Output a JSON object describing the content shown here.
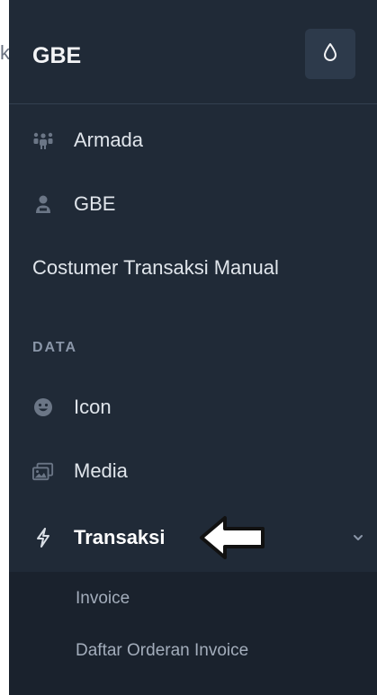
{
  "edge_fragment": "k",
  "brand": {
    "title": "GBE"
  },
  "theme_toggle": {
    "icon": "droplet-icon"
  },
  "menu": [
    {
      "id": "armada",
      "label": "Armada",
      "icon": "users-icon"
    },
    {
      "id": "gbe",
      "label": "GBE",
      "icon": "user-tie-icon"
    },
    {
      "id": "costumer",
      "label": "Costumer Transaksi Manual",
      "icon": ""
    }
  ],
  "section": {
    "label": "DATA"
  },
  "data_menu": [
    {
      "id": "icon",
      "label": "Icon",
      "icon": "smile-icon"
    },
    {
      "id": "media",
      "label": "Media",
      "icon": "images-icon"
    },
    {
      "id": "transaksi",
      "label": "Transaksi",
      "icon": "bolt-icon",
      "active": true,
      "expanded": true
    }
  ],
  "submenu": [
    {
      "label": "Invoice"
    },
    {
      "label": "Daftar Orderan Invoice"
    }
  ],
  "annotation": {
    "type": "arrow-pointing-left"
  },
  "colors": {
    "sidebar_bg": "#202a37",
    "submenu_bg": "#1a222d",
    "toggle_bg": "#2d3a4b",
    "section_text": "#8a96a8"
  }
}
